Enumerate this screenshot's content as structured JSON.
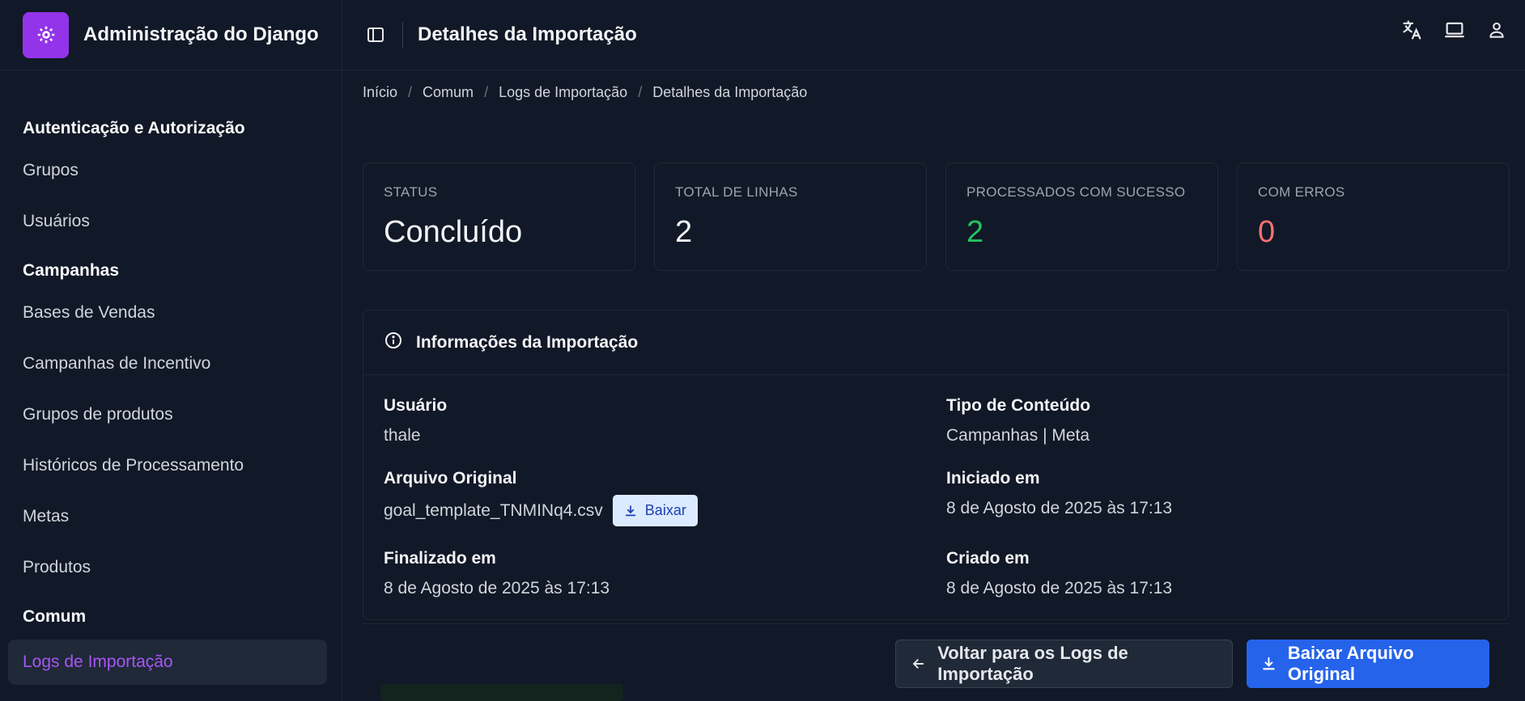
{
  "brand": {
    "title": "Administração do Django",
    "icon": "gear-icon",
    "accent": "#9333ea"
  },
  "header": {
    "title": "Detalhes da Importação"
  },
  "sidebar": {
    "sections": [
      {
        "title": "Autenticação e Autorização",
        "items": [
          "Grupos",
          "Usuários"
        ]
      },
      {
        "title": "Campanhas",
        "items": [
          "Bases de Vendas",
          "Campanhas de Incentivo",
          "Grupos de produtos",
          "Históricos de Processamento",
          "Metas",
          "Produtos"
        ]
      },
      {
        "title": "Comum",
        "items": [
          "Logs de Importação"
        ]
      }
    ],
    "active_item": "Logs de Importação"
  },
  "breadcrumb": [
    "Início",
    "Comum",
    "Logs de Importação",
    "Detalhes da Importação"
  ],
  "stats": [
    {
      "label": "STATUS",
      "value": "Concluído"
    },
    {
      "label": "TOTAL DE LINHAS",
      "value": "2"
    },
    {
      "label": "PROCESSADOS COM SUCESSO",
      "value": "2"
    },
    {
      "label": "COM ERROS",
      "value": "0"
    }
  ],
  "info": {
    "title": "Informações da Importação",
    "user_label": "Usuário",
    "user_value": "thale",
    "content_type_label": "Tipo de Conteúdo",
    "content_type_value": "Campanhas | Meta",
    "file_label": "Arquivo Original",
    "file_value": "goal_template_TNMINq4.csv",
    "file_button": "Baixar",
    "started_label": "Iniciado em",
    "started_value": "8 de Agosto de 2025 às 17:13",
    "finished_label": "Finalizado em",
    "finished_value": "8 de Agosto de 2025 às 17:13",
    "created_label": "Criado em",
    "created_value": "8 de Agosto de 2025 às 17:13"
  },
  "actions": {
    "back_label": "Voltar para os Logs de Importação",
    "download_label": "Baixar Arquivo Original"
  },
  "colors": {
    "success": "#22c55e",
    "error": "#f87171",
    "primary": "#2563eb",
    "active_nav": "#a855f7"
  }
}
